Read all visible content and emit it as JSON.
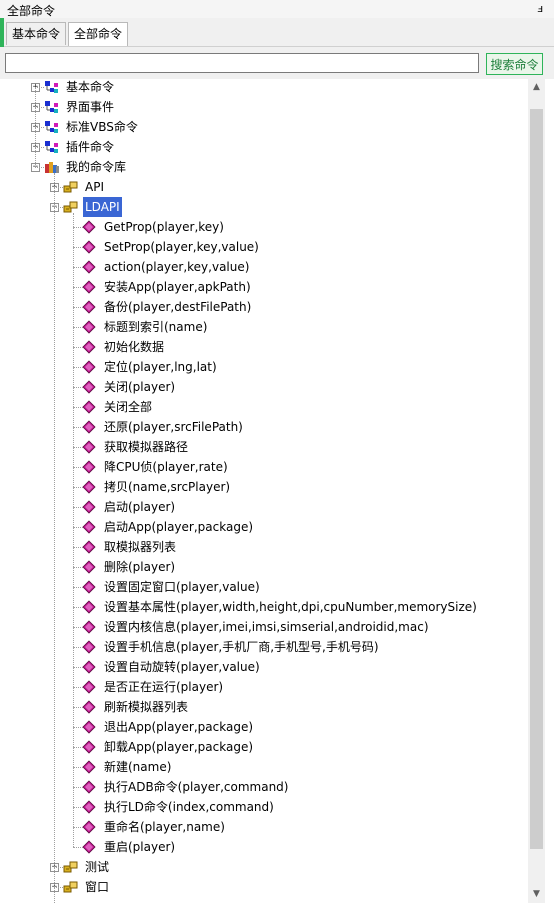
{
  "panel": {
    "title": "全部命令",
    "pin_glyph": "ⅎ"
  },
  "tabs": [
    {
      "label": "基本命令",
      "active": false
    },
    {
      "label": "全部命令",
      "active": true
    }
  ],
  "search": {
    "value": "",
    "placeholder": "",
    "button_label": "搜索命令"
  },
  "tree": {
    "top_level": [
      {
        "label": "基本命令",
        "icon": "command-group-icon"
      },
      {
        "label": "界面事件",
        "icon": "command-group-icon"
      },
      {
        "label": "标准VBS命令",
        "icon": "command-group-icon"
      },
      {
        "label": "插件命令",
        "icon": "command-group-icon"
      },
      {
        "label": "我的命令库",
        "icon": "library-icon"
      }
    ],
    "library_children": [
      {
        "label": "API",
        "icon": "module-icon"
      },
      {
        "label": "LDAPI",
        "icon": "module-icon",
        "selected": true
      }
    ],
    "ldapi_functions": [
      "GetProp(player,key)",
      "SetProp(player,key,value)",
      "action(player,key,value)",
      "安装App(player,apkPath)",
      "备份(player,destFilePath)",
      "标题到索引(name)",
      "初始化数据",
      "定位(player,lng,lat)",
      "关闭(player)",
      "关闭全部",
      "还原(player,srcFilePath)",
      "获取模拟器路径",
      "降CPU侦(player,rate)",
      "拷贝(name,srcPlayer)",
      "启动(player)",
      "启动App(player,package)",
      "取模拟器列表",
      "删除(player)",
      "设置固定窗口(player,value)",
      "设置基本属性(player,width,height,dpi,cpuNumber,memorySize)",
      "设置内核信息(player,imei,imsi,simserial,androidid,mac)",
      "设置手机信息(player,手机厂商,手机型号,手机号码)",
      "设置自动旋转(player,value)",
      "是否正在运行(player)",
      "刷新模拟器列表",
      "退出App(player,package)",
      "卸载App(player,package)",
      "新建(name)",
      "执行ADB命令(player,command)",
      "执行LD命令(index,command)",
      "重命名(player,name)",
      "重启(player)"
    ],
    "library_more": [
      {
        "label": "测试",
        "icon": "module-icon"
      },
      {
        "label": "窗口",
        "icon": "module-icon"
      }
    ]
  },
  "colors": {
    "accent_green": "#2fb45a",
    "selection_blue": "#3a66d4",
    "function_diamond": "#c0168f"
  }
}
